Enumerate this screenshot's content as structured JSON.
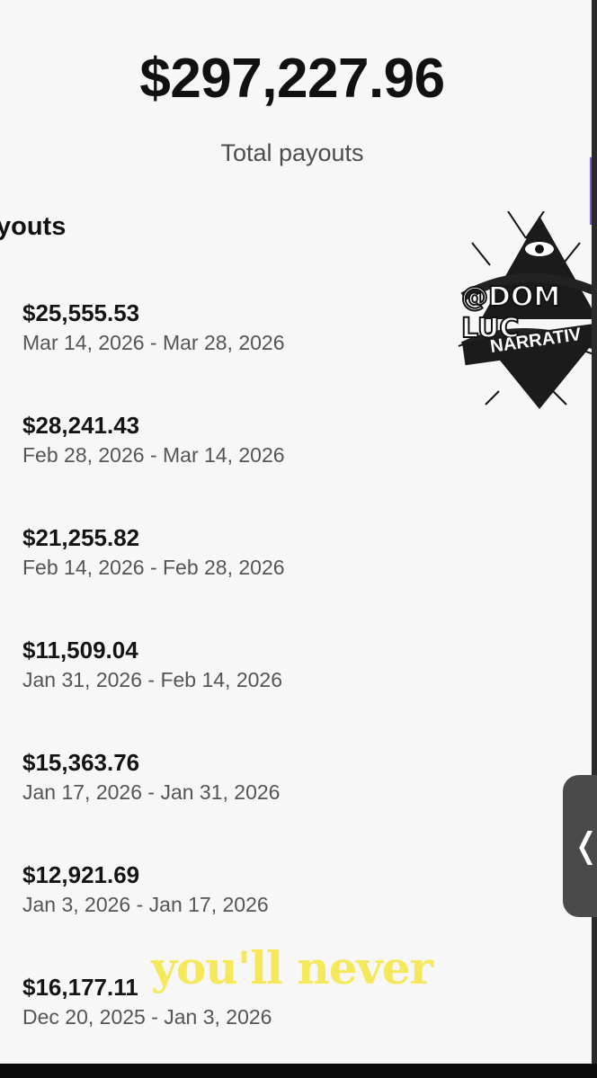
{
  "summary": {
    "total_amount": "$297,227.96",
    "total_label": "Total payouts"
  },
  "section": {
    "title": "youts"
  },
  "payouts": [
    {
      "amount": "$25,555.53",
      "range": "Mar 14, 2026 - Mar 28, 2026"
    },
    {
      "amount": "$28,241.43",
      "range": "Feb 28, 2026 - Mar 14, 2026"
    },
    {
      "amount": "$21,255.82",
      "range": "Feb 14, 2026 - Feb 28, 2026"
    },
    {
      "amount": "$11,509.04",
      "range": "Jan 31, 2026 - Feb 14, 2026"
    },
    {
      "amount": "$15,363.76",
      "range": "Jan 17, 2026 - Jan 31, 2026"
    },
    {
      "amount": "$12,921.69",
      "range": "Jan 3, 2026 - Jan 17, 2026"
    },
    {
      "amount": "$16,177.11",
      "range": "Dec 20, 2025 - Jan 3, 2026"
    }
  ],
  "overlay": {
    "caption": "you'll never",
    "watermark_line1": "@DOM LUC",
    "watermark_line2": "NARRATIV",
    "handle_glyph": "❬"
  },
  "colors": {
    "caption": "#f5e85a",
    "edge_tab": "#7b5bd6"
  }
}
